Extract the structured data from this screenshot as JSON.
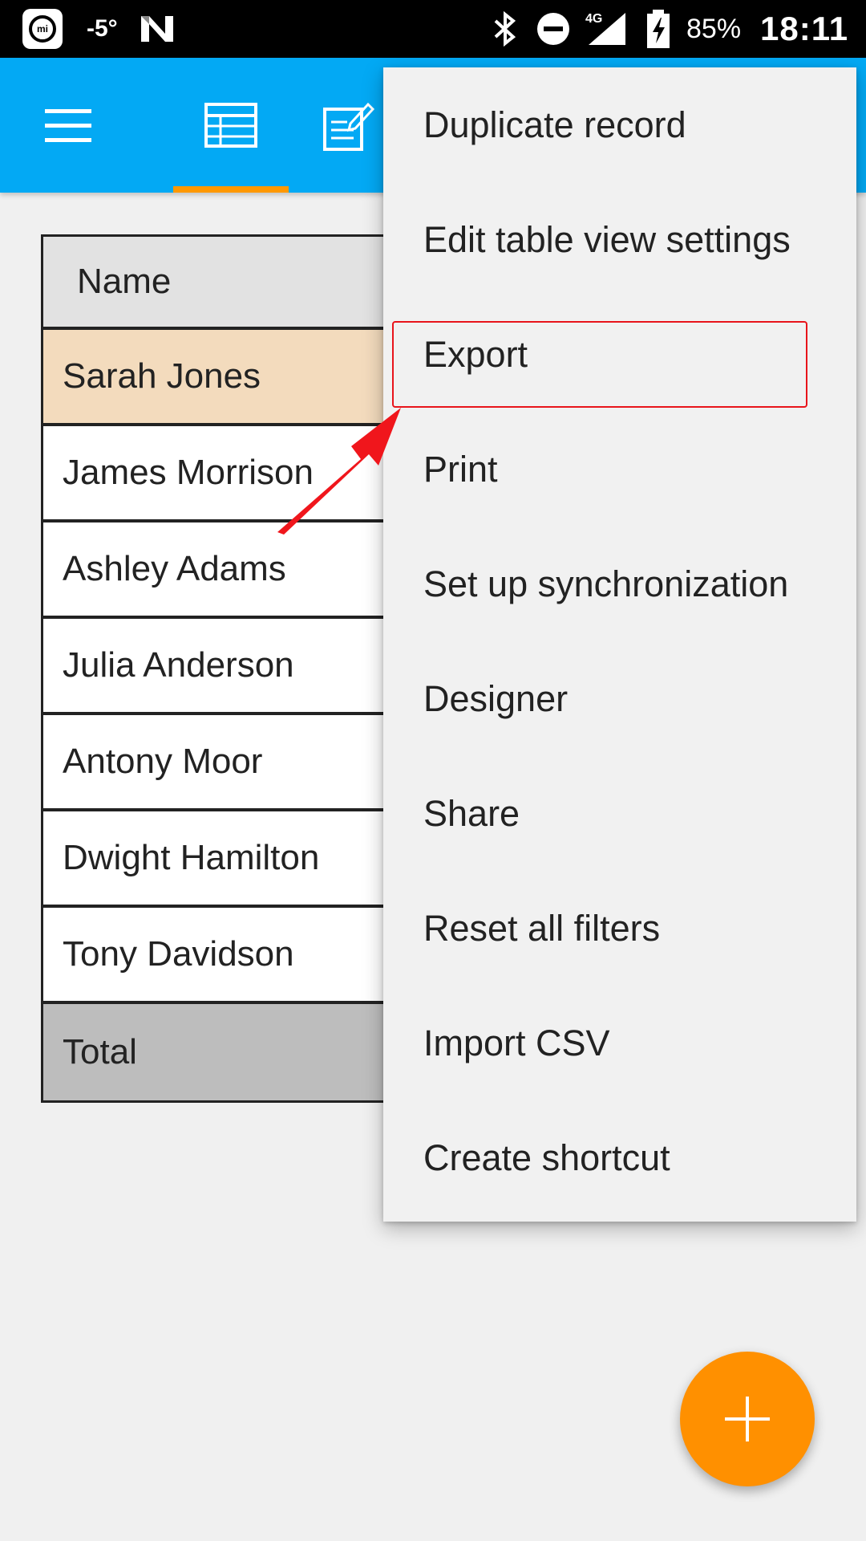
{
  "status_bar": {
    "temperature": "-5°",
    "battery_percent": "85%",
    "time": "18:11",
    "icons": [
      "mi-icon",
      "n-icon",
      "bluetooth-icon",
      "do-not-disturb-icon",
      "signal-4g-icon",
      "battery-charging-icon"
    ],
    "network_label": "4G"
  },
  "app_bar": {
    "color": "#03a9f4",
    "accent": "#ff9800",
    "icons": [
      "hamburger-menu-icon",
      "table-view-icon",
      "form-edit-icon"
    ]
  },
  "table": {
    "header": "Name",
    "rows": [
      "Sarah Jones",
      "James Morrison",
      "Ashley Adams",
      "Julia Anderson",
      "Antony Moor",
      "Dwight Hamilton",
      "Tony Davidson"
    ],
    "total_label": "Total",
    "selected_row": "Sarah Jones"
  },
  "menu": {
    "items": [
      "Duplicate record",
      "Edit table view settings",
      "Export",
      "Print",
      "Set up synchronization",
      "Designer",
      "Share",
      "Reset all filters",
      "Import CSV",
      "Create shortcut"
    ],
    "highlighted": "Export"
  },
  "fab": {
    "icon": "plus-icon",
    "color": "#ff9000"
  }
}
